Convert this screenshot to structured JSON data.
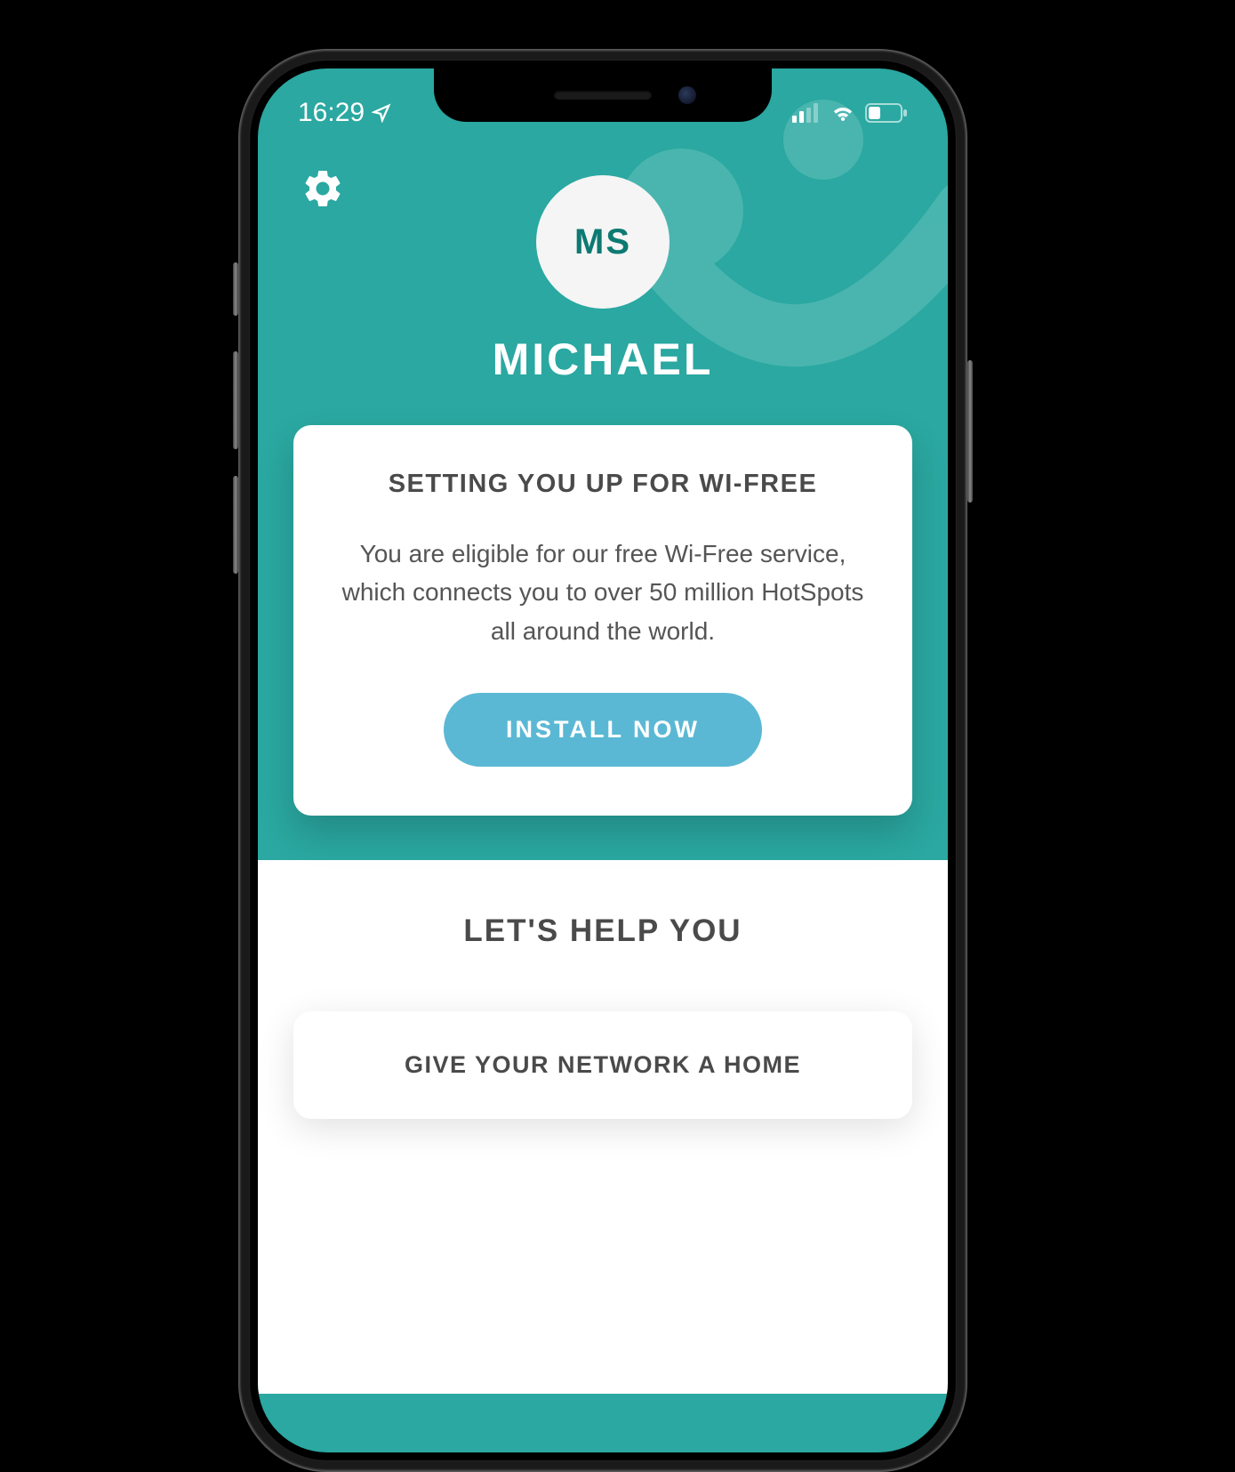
{
  "status": {
    "time": "16:29"
  },
  "profile": {
    "initials": "MS",
    "name": "MICHAEL"
  },
  "wifreeCard": {
    "title": "SETTING YOU UP FOR WI-FREE",
    "body": "You are eligible for our free Wi-Free service, which connects you to over 50 million HotSpots all around the world.",
    "button": "INSTALL NOW"
  },
  "helpSection": {
    "title": "LET'S HELP YOU",
    "networkCard": {
      "title": "GIVE YOUR NETWORK A HOME"
    }
  }
}
